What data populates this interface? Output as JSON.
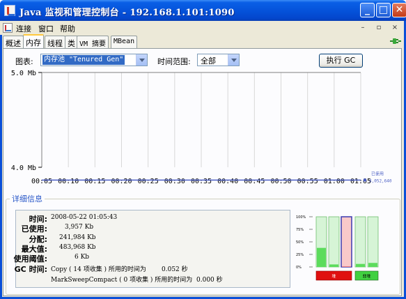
{
  "window": {
    "title": "Java 监视和管理控制台 - 192.168.1.101:1090",
    "minimize_glyph": "_",
    "maximize_glyph": "□",
    "close_glyph": "✕"
  },
  "menu": {
    "items": [
      "连接",
      "窗口",
      "帮助"
    ],
    "mdi_minimize": "–",
    "mdi_restore": "▫",
    "mdi_close": "×"
  },
  "tabs": [
    {
      "label": "概述",
      "active": false
    },
    {
      "label": "内存",
      "active": true
    },
    {
      "label": "线程",
      "active": false
    },
    {
      "label": "类",
      "active": false
    },
    {
      "label": "VM 摘要",
      "active": false
    },
    {
      "label": "MBean",
      "active": false
    }
  ],
  "controls": {
    "chart_label": "图表:",
    "chart_selected": "内存池 \"Tenured Gen\"",
    "range_label": "时间范围:",
    "range_selected": "全部",
    "gc_button": "执行 GC"
  },
  "chart_data": {
    "type": "line",
    "y_tick_labels": [
      "5.0 Mb",
      "4.0 Mb"
    ],
    "ylim_mb": [
      4.0,
      5.0
    ],
    "x_tick_labels": [
      "00:05",
      "00:10",
      "00:15",
      "00:20",
      "00:25",
      "00:30",
      "00:35",
      "00:40",
      "00:45",
      "00:50",
      "00:55",
      "01:00",
      "01:05"
    ],
    "series": [
      {
        "name": "已使用",
        "value_label": "4,052,640",
        "value_bytes": 4052640,
        "color": "#4b5fc4"
      }
    ],
    "grid": true
  },
  "details": {
    "group_title": "详细信息",
    "rows": {
      "time_label": "时间:",
      "time_value": "2008-05-22 01:05:43",
      "used_label": "已使用:",
      "used_value": "3,957 Kb",
      "committed_label": "分配:",
      "committed_value": "241,984 Kb",
      "max_label": "最大值:",
      "max_value": "483,968 Kb",
      "threshold_label": "使用阈值:",
      "threshold_value": "6 Kb",
      "gc_label": "GC 时间:",
      "gc1": "Copy ( 14 项收集 ) 所用的时间为",
      "gc1_time": "0.052 秒",
      "gc2": "MarkSweepCompact ( 0 项收集 ) 所用的时间为",
      "gc2_time": "0.000 秒"
    }
  },
  "pool_bars": {
    "axis_labels": [
      "100%",
      "75%",
      "50%",
      "25%",
      "0%"
    ],
    "heap_label": "堆",
    "nonheap_label": "非堆",
    "heap_color": "#e01010",
    "nonheap_color": "#40d040",
    "bars": [
      {
        "name": "heap-eden",
        "fill_fraction": 0.38,
        "selected": false,
        "group": "heap"
      },
      {
        "name": "heap-survivor",
        "fill_fraction": 0.05,
        "selected": false,
        "group": "heap"
      },
      {
        "name": "heap-tenured",
        "fill_fraction": 0.01,
        "selected": true,
        "group": "heap"
      },
      {
        "name": "nonheap-code-cache",
        "fill_fraction": 0.06,
        "selected": false,
        "group": "nonheap"
      },
      {
        "name": "nonheap-perm-gen",
        "fill_fraction": 0.08,
        "selected": false,
        "group": "nonheap"
      }
    ]
  }
}
